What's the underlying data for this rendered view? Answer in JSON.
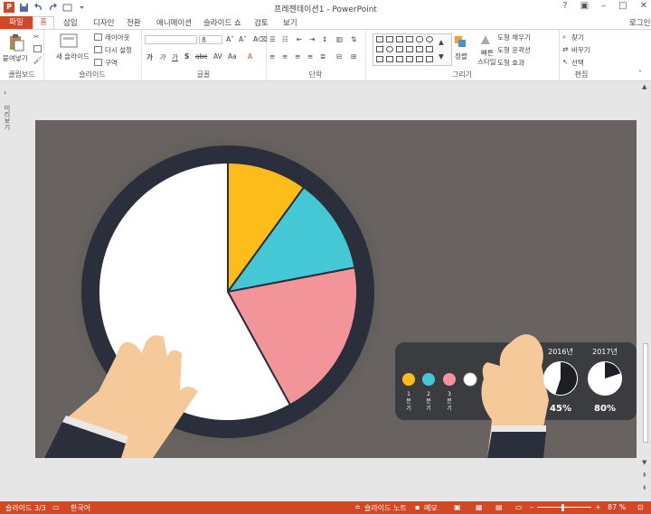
{
  "window": {
    "title": "프레젠테이션1 - PowerPoint",
    "app_badge": "P",
    "help": "?",
    "login": "로그인"
  },
  "tabs": [
    "파일",
    "홈",
    "삽입",
    "디자인",
    "전환",
    "애니메이션",
    "슬라이드 쇼",
    "검토",
    "보기"
  ],
  "ribbon": {
    "clipboard": {
      "label": "클립보드",
      "paste": "붙여넣기"
    },
    "slides": {
      "label": "슬라이드",
      "new_slide": "새 슬라이드",
      "layout": "레이아웃",
      "reset": "다시 설정",
      "section": "구역"
    },
    "font": {
      "label": "글꼴",
      "size": "8"
    },
    "paragraph": {
      "label": "단락"
    },
    "drawing": {
      "label": "그리기",
      "arrange": "정렬",
      "quick_styles_1": "빠른",
      "quick_styles_2": "스타일",
      "fill": "도형 채우기",
      "outline": "도형 윤곽선",
      "effects": "도형 효과"
    },
    "editing": {
      "label": "편집",
      "find": "찾기",
      "replace": "바꾸기",
      "select": "선택"
    }
  },
  "left_pane": {
    "label": "미리보기"
  },
  "slide": {
    "legend": [
      "1 분기",
      "2 분기",
      "3 분기"
    ],
    "legend_colors": [
      "#fcbd1b",
      "#45c8d6",
      "#f3939a"
    ],
    "year_1": "2016년",
    "year_2": "2017년",
    "pct_1": "45%",
    "pct_2": "80%",
    "progress_1": 0.45,
    "progress_2": 0.8
  },
  "chart_data": {
    "type": "pie",
    "series": [
      {
        "values": [
          10,
          12,
          20,
          58
        ]
      }
    ],
    "colors": [
      "#fcbd1b",
      "#45c8d6",
      "#f3939a",
      "#ffffff"
    ]
  },
  "status": {
    "slide": "슬라이드 3/3",
    "language": "한국어",
    "notes": "슬라이드 노트",
    "comments": "메모",
    "zoom": "87 %",
    "zoom_level": 0.87
  }
}
